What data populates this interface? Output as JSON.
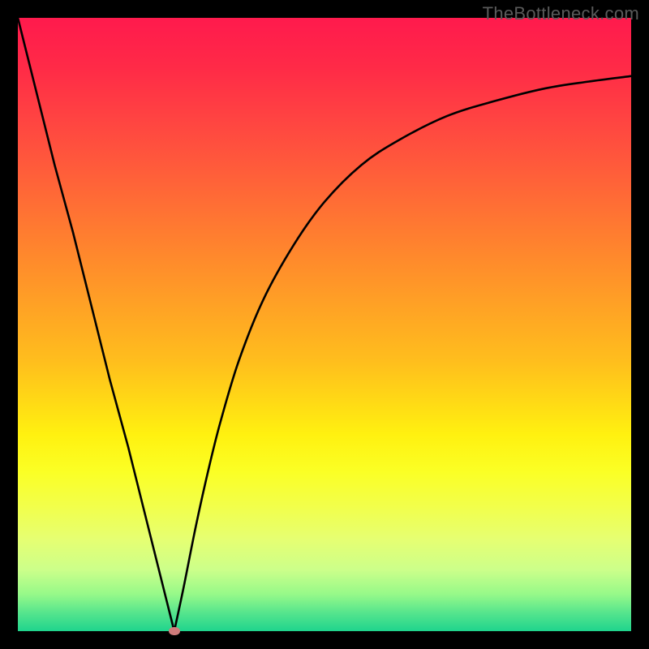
{
  "watermark": "TheBottleneck.com",
  "colors": {
    "page_bg": "#000000",
    "curve_stroke": "#000000",
    "marker": "#cf7b7b",
    "watermark": "#5a5a5a"
  },
  "chart_data": {
    "type": "line",
    "title": "",
    "xlabel": "",
    "ylabel": "",
    "xlim": [
      0,
      100
    ],
    "ylim": [
      0,
      100
    ],
    "grid": false,
    "legend": false,
    "notch_x": 25.5,
    "series": [
      {
        "name": "bottleneck-curve",
        "x": [
          0,
          3,
          6,
          9,
          12,
          15,
          18,
          21,
          24,
          25.5,
          27,
          29,
          31,
          33,
          36,
          40,
          45,
          50,
          56,
          62,
          70,
          78,
          86,
          93,
          100
        ],
        "y": [
          100,
          88,
          76,
          65,
          53,
          41,
          30,
          18,
          6,
          0,
          7,
          17,
          26,
          34,
          44,
          54,
          63,
          70,
          76,
          80,
          84,
          86.5,
          88.5,
          89.6,
          90.5
        ]
      }
    ],
    "annotations": [
      {
        "name": "notch-marker",
        "x": 25.5,
        "y": 0
      }
    ]
  }
}
